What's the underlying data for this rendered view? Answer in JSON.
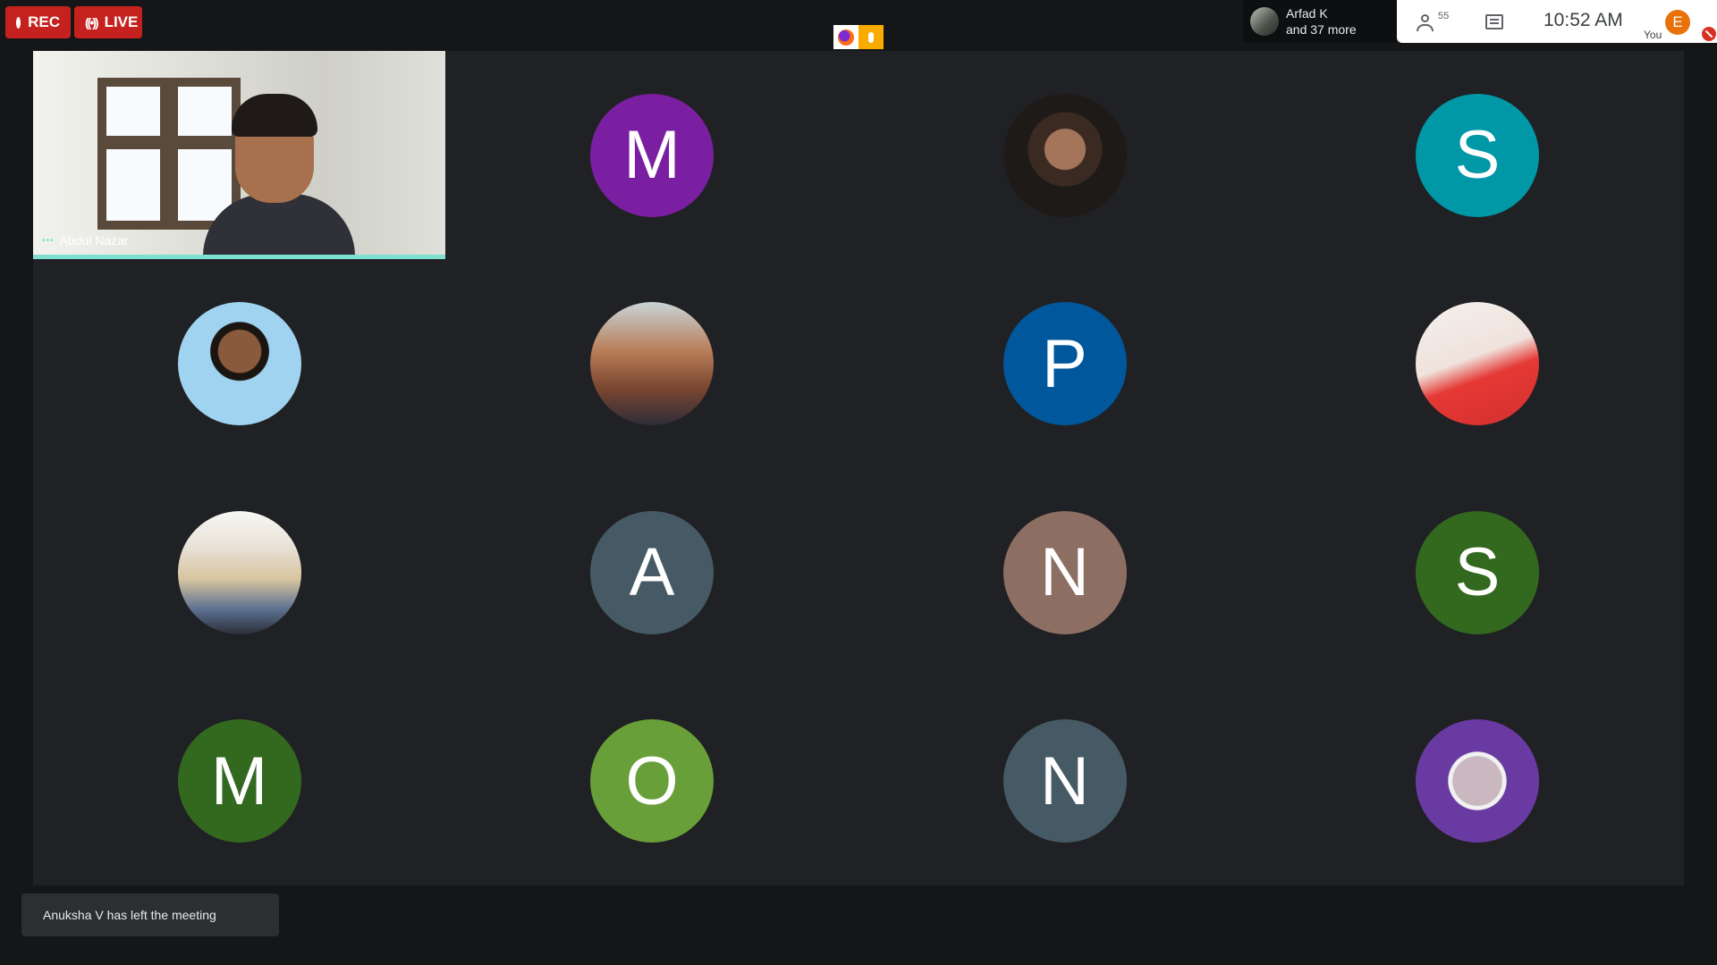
{
  "top_bar": {
    "rec_label": "REC",
    "live_label": "LIVE",
    "presenter_name": "Arfad K",
    "presenter_more": "and 37 more",
    "people_count": "55",
    "clock": "10:52  AM",
    "self_initial": "E",
    "self_label": "You"
  },
  "main_video": {
    "name": "Abdul Nazar"
  },
  "tiles": [
    {
      "initial": "M",
      "color": "#7b1fa2",
      "photo": false
    },
    {
      "initial": "",
      "photo": true,
      "photo_desc": "portrait-woman-dark"
    },
    {
      "initial": "S",
      "color": "#0097a7",
      "photo": false
    },
    {
      "initial": "",
      "photo": true,
      "photo_desc": "portrait-man-blue"
    },
    {
      "initial": "",
      "photo": true,
      "photo_desc": "man-speaking-in-classroom"
    },
    {
      "initial": "P",
      "color": "#01579b",
      "photo": false
    },
    {
      "initial": "",
      "photo": true,
      "photo_desc": "woman-red-top"
    },
    {
      "initial": "",
      "photo": true,
      "photo_desc": "group-holding-certificate"
    },
    {
      "initial": "A",
      "color": "#455a64",
      "photo": false
    },
    {
      "initial": "N",
      "color": "#8d6e63",
      "photo": false
    },
    {
      "initial": "S",
      "color": "#33691e",
      "photo": false
    },
    {
      "initial": "M",
      "color": "#33691e",
      "photo": false
    },
    {
      "initial": "O",
      "color": "#689f38",
      "photo": false
    },
    {
      "initial": "N",
      "color": "#455a64",
      "photo": false
    },
    {
      "initial": "",
      "photo": true,
      "photo_desc": "woman-hijab-purple-bg"
    }
  ],
  "toast": {
    "message": "Anuksha V has left the meeting"
  }
}
